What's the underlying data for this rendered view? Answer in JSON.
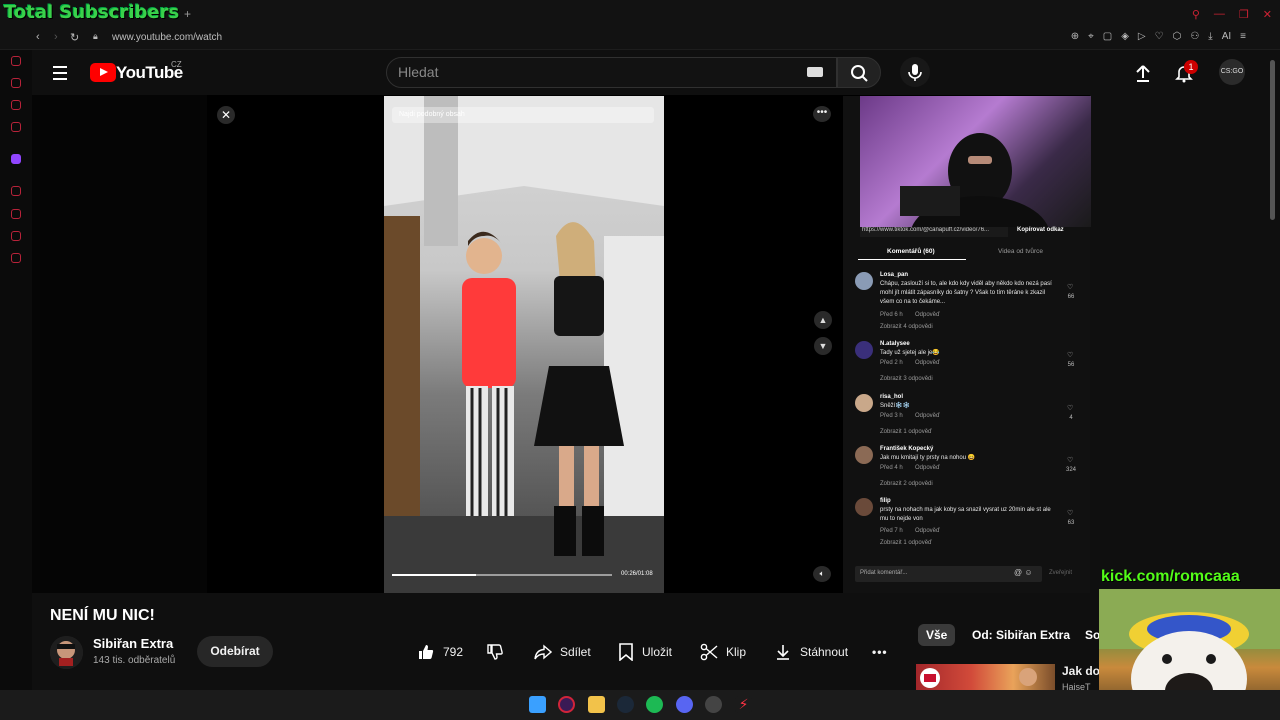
{
  "overlay": {
    "total_subscribers": "Total Subscribers",
    "kick_url": "kick.com/romcaaa"
  },
  "browser": {
    "url": "www.youtube.com/watch"
  },
  "header": {
    "logo_text": "YouTube",
    "region": "CZ",
    "search_placeholder": "Hledat",
    "notification_count": "1",
    "avatar_text": "CS:GO"
  },
  "player": {
    "video_search_placeholder": "Najdi podobný obsah",
    "time": "00:26/01:08",
    "progress": 0.38
  },
  "side_panel": {
    "link": "https://www.tiktok.com/@canapuff.cz/video/76...",
    "copy_link": "Kopírovat odkaz",
    "tabs": [
      "Komentářů (60)",
      "Videa od tvůrce"
    ],
    "comments": [
      {
        "user": "Losa_pan",
        "text": "Chápu, zaslouží si to, ale kdo kdy viděl aby někdo kdo nezá pasí mohl jít mlátit zápasníky do šatny ? Však to tím těráne k zkazil všem co na to čekáme...",
        "time": "Před 6 h",
        "reply": "Odpověď",
        "more": "Zobrazit 4 odpovědi",
        "likes": "66"
      },
      {
        "user": "N.atalysee",
        "text": "Tady už sjetej ale je😂",
        "time": "Před 2 h",
        "reply": "Odpověď",
        "more": "Zobrazit 3 odpovědi",
        "likes": "56"
      },
      {
        "user": "risa_hol",
        "text": "Sněží❄️❄️",
        "time": "Před 3 h",
        "reply": "Odpověď",
        "more": "Zobrazit 1 odpověď",
        "likes": "4"
      },
      {
        "user": "František Kopecký",
        "text": "Jak mu kmitají ty prsty na nohou 😄",
        "time": "Před 4 h",
        "reply": "Odpověď",
        "more": "Zobrazit 2 odpovědi",
        "likes": "324"
      },
      {
        "user": "filip",
        "text": "prsty na nohach ma jak koby sa snazil vysrat uz 20min ale st ale mu to nejde von",
        "time": "Před 7 h",
        "reply": "Odpověď",
        "more": "Zobrazit 1 odpověď",
        "likes": "63"
      }
    ],
    "add_comment_placeholder": "Přidat komentář...",
    "post_label": "Zveřejnit"
  },
  "video": {
    "title": "NENÍ MU NIC!",
    "channel": "Sibiřan Extra",
    "subscribers": "143 tis. odběratelů",
    "subscribe_label": "Odebírat",
    "likes": "792",
    "share": "Sdílet",
    "save": "Uložit",
    "clip": "Klip",
    "download": "Stáhnout"
  },
  "related": {
    "chips": [
      "Vše",
      "Od: Sibiřan Extra",
      "So"
    ],
    "title": "Jak dop",
    "channel": "HaiseT"
  },
  "colors": {
    "brand_red": "#ff0000",
    "kick_green": "#53fc18",
    "overlay_green": "#3ad14a"
  }
}
